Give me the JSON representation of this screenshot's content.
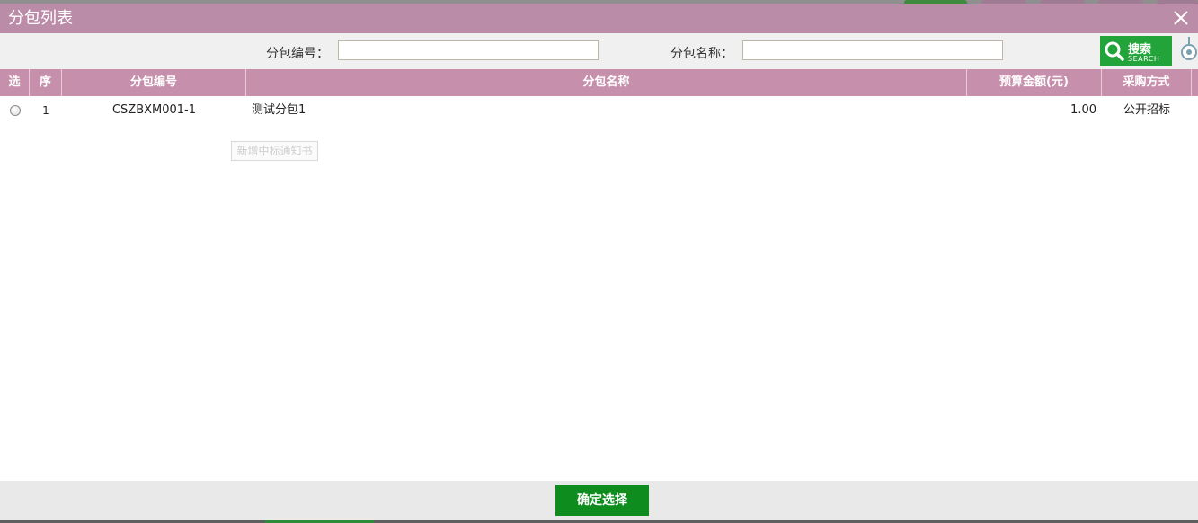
{
  "colors": {
    "title_bar": "#bb8ca8",
    "table_header": "#c68fab",
    "search_button": "#22a43a",
    "confirm_button": "#0e8c1d"
  },
  "dialog": {
    "title": "分包列表",
    "close_icon": "close-icon"
  },
  "search": {
    "package_no_label": "分包编号：",
    "package_no_value": "",
    "package_name_label": "分包名称：",
    "package_name_value": "",
    "button_label": "搜索",
    "button_sublabel": "SEARCH"
  },
  "table": {
    "columns": [
      "选",
      "序",
      "分包编号",
      "分包名称",
      "预算金额(元)",
      "采购方式"
    ],
    "rows": [
      {
        "selected": false,
        "index": "1",
        "package_no": "CSZBXM001-1",
        "package_name": "测试分包1",
        "budget": "1.00",
        "method": "公开招标"
      }
    ]
  },
  "ghost_button": "新增中标通知书",
  "footer": {
    "confirm_label": "确定选择"
  }
}
